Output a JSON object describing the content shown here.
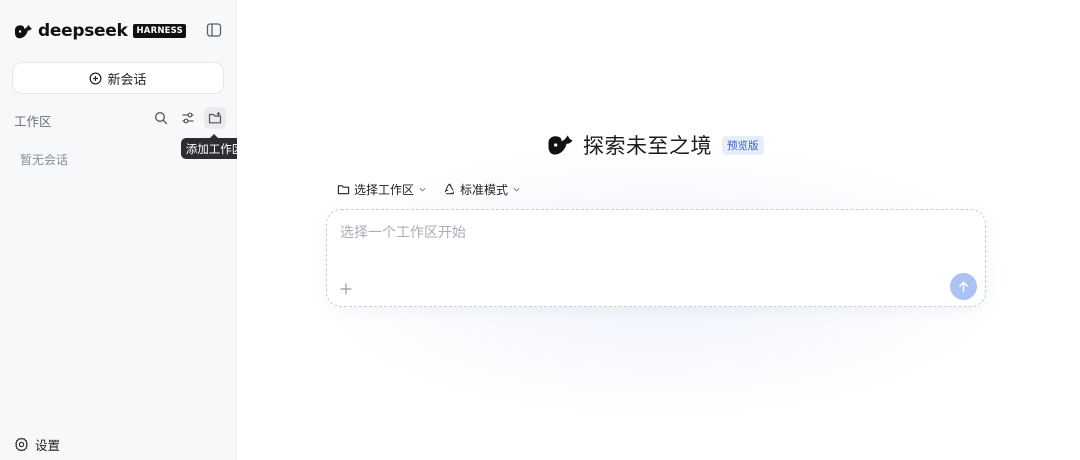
{
  "sidebar": {
    "brand": {
      "name": "deepseek",
      "badge": "HARNESS"
    },
    "new_chat_label": "新会话",
    "workspace_label": "工作区",
    "tooltip": "添加工作区",
    "empty_text": "暂无会话",
    "settings_label": "设置"
  },
  "hero": {
    "title": "探索未至之境",
    "badge": "预览版"
  },
  "controls": {
    "workspace_select": "选择工作区",
    "mode_select": "标准模式"
  },
  "composer": {
    "placeholder": "选择一个工作区开始"
  },
  "colors": {
    "accent": "#abc3f2",
    "badge_bg": "#e6eefc",
    "badge_text": "#3c63b8",
    "sidebar_bg": "#f7f8fa"
  },
  "icons": {
    "brand": "whale-logo-icon",
    "collapse": "sidebar-toggle-icon",
    "new_chat": "plus-circle-icon",
    "search": "search-icon",
    "filter": "sliders-icon",
    "add_workspace": "folder-plus-icon",
    "settings": "gear-icon",
    "folder": "folder-icon",
    "mode": "recycle-icon",
    "chevron": "chevron-down-icon",
    "attach": "plus-icon",
    "send": "arrow-up-icon"
  }
}
